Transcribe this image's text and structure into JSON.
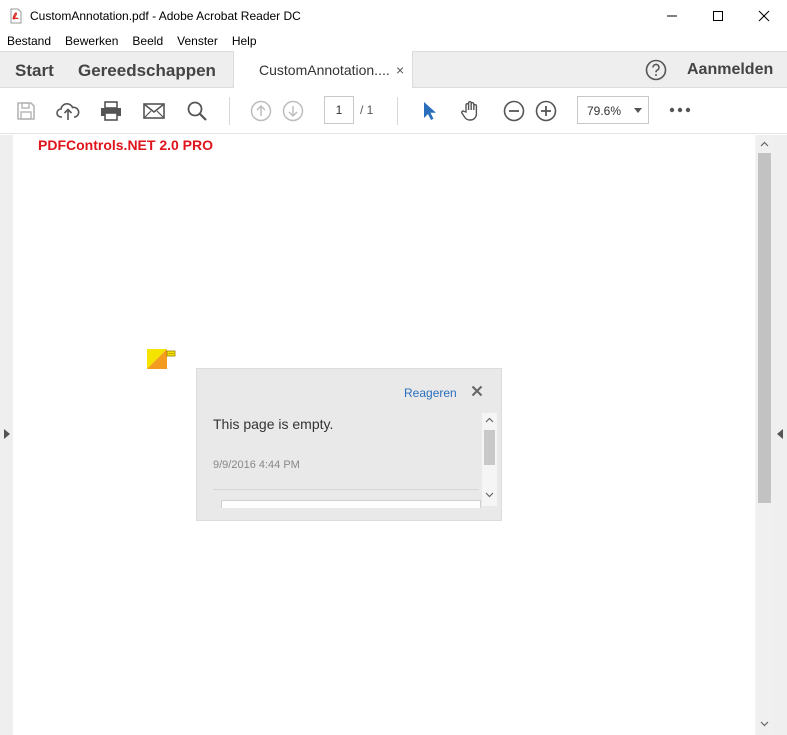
{
  "window": {
    "title": "CustomAnnotation.pdf - Adobe Acrobat Reader DC"
  },
  "menu": {
    "items": [
      "Bestand",
      "Bewerken",
      "Beeld",
      "Venster",
      "Help"
    ]
  },
  "tabs": {
    "start": "Start",
    "tools": "Gereedschappen",
    "document": "CustomAnnotation....",
    "close": "×",
    "signin": "Aanmelden"
  },
  "toolbar": {
    "page_current": "1",
    "page_total": "/  1",
    "zoom": "79.6%"
  },
  "document": {
    "watermark": "PDFControls.NET 2.0 PRO"
  },
  "popup": {
    "reply_label": "Reageren",
    "content": "This page is empty.",
    "date": "9/9/2016  4:44 PM"
  },
  "colors": {
    "accent_blue": "#2a6fbe",
    "watermark_red": "#e0141b",
    "note_yellow": "#f5e400",
    "note_orange": "#f39c1f"
  }
}
